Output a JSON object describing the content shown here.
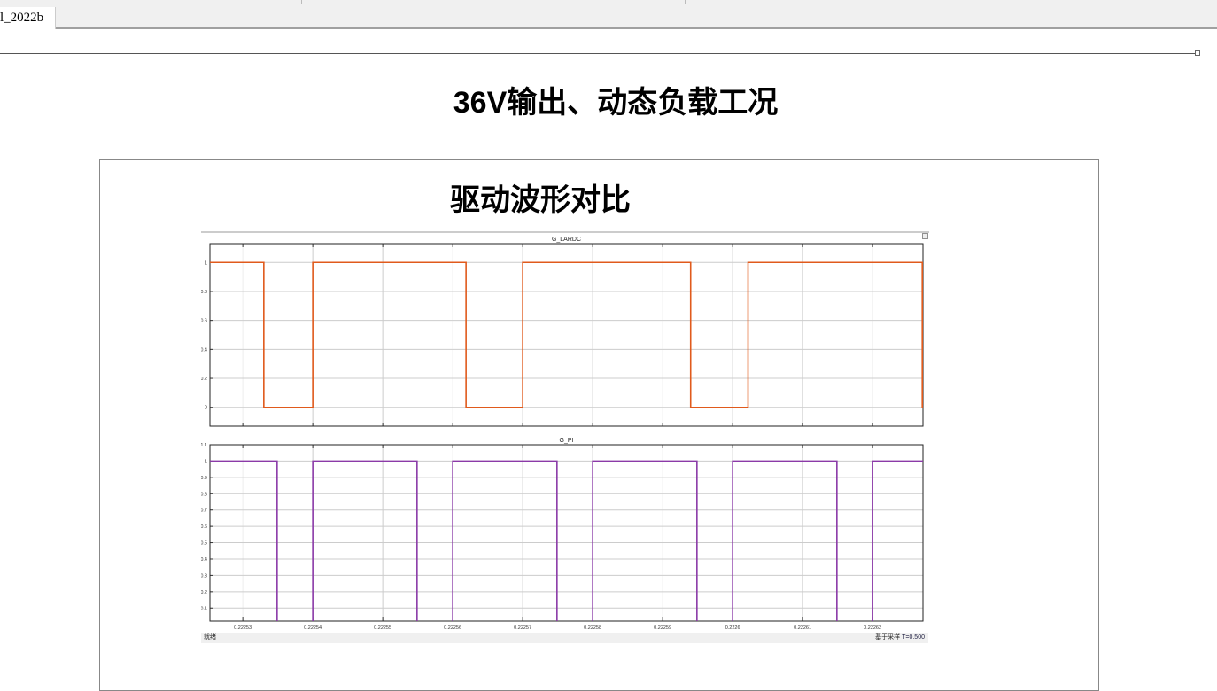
{
  "app": {
    "tab_label": "l_2022b"
  },
  "page": {
    "title": "36V输出、动态负载工况",
    "subtitle": "驱动波形对比"
  },
  "scope": {
    "status_left": "就绪",
    "status_mode": "基于采样",
    "status_time": "T=0.500",
    "x_ticks": [
      "0.22253",
      "0.22254",
      "0.22255",
      "0.22256",
      "0.22257",
      "0.22258",
      "0.22259",
      "0.2226",
      "0.22261",
      "0.22262"
    ],
    "x_tick_values": [
      0.22253,
      0.22254,
      0.22255,
      0.22256,
      0.22257,
      0.22258,
      0.22259,
      0.2226,
      0.22261,
      0.22262
    ],
    "xlim": [
      0.2225253,
      0.2226272
    ],
    "plots": [
      {
        "title": "G_LARDC",
        "color": "#e05a1c",
        "ylim": [
          -0.13,
          1.13
        ],
        "y_ticks": [
          "0",
          "0.2",
          "0.4",
          "0.6",
          "0.8",
          "1"
        ],
        "y_tick_values": [
          0,
          0.2,
          0.4,
          0.6,
          0.8,
          1
        ],
        "initial": 1,
        "transitions": [
          0.222533,
          0.22254,
          0.2225619,
          0.22257,
          0.222594,
          0.2226022,
          0.2226271
        ]
      },
      {
        "title": "G_PI",
        "color": "#8b3aa8",
        "ylim": [
          0.02,
          1.1
        ],
        "y_ticks": [
          "0.1",
          "0.2",
          "0.3",
          "0.4",
          "0.5",
          "0.6",
          "0.7",
          "0.8",
          "0.9",
          "1",
          "1.1"
        ],
        "y_tick_values": [
          0.1,
          0.2,
          0.3,
          0.4,
          0.5,
          0.6,
          0.7,
          0.8,
          0.9,
          1,
          1.1
        ],
        "initial": 1,
        "transitions": [
          0.2225349,
          0.22254,
          0.2225549,
          0.22256,
          0.2225749,
          0.22258,
          0.2225949,
          0.2226,
          0.2226149,
          0.22262
        ]
      }
    ]
  }
}
